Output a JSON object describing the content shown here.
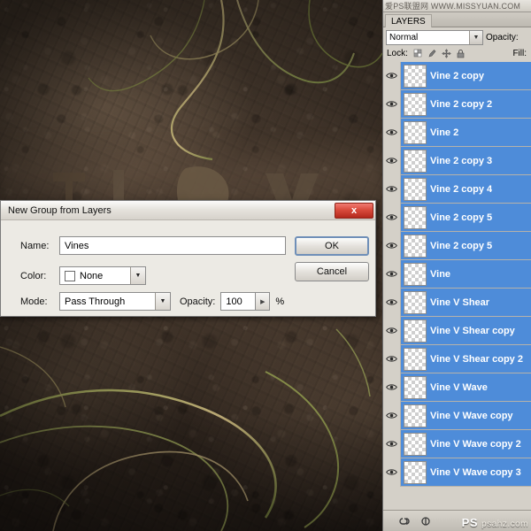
{
  "background": {
    "description": "dark rock texture with vines and embossed letters"
  },
  "layers_panel": {
    "watermark": "爱PS联盟网 WWW.MISSYUAN.COM",
    "tab_label": "LAYERS",
    "blend_mode": "Normal",
    "blend_mode_arrow": "▼",
    "opacity_label": "Opacity:",
    "lock_label": "Lock:",
    "fill_label": "Fill:",
    "lock_icons": [
      "transparency-lock-icon",
      "brush-lock-icon",
      "move-lock-icon",
      "all-lock-icon"
    ],
    "layers": [
      {
        "name": "Vine 2 copy",
        "visible": true,
        "selected": true
      },
      {
        "name": "Vine 2 copy 2",
        "visible": true,
        "selected": true
      },
      {
        "name": "Vine 2",
        "visible": true,
        "selected": true
      },
      {
        "name": "Vine 2 copy 3",
        "visible": true,
        "selected": true
      },
      {
        "name": "Vine 2 copy 4",
        "visible": true,
        "selected": true
      },
      {
        "name": "Vine 2 copy 5",
        "visible": true,
        "selected": true
      },
      {
        "name": "Vine 2 copy 5",
        "visible": true,
        "selected": true
      },
      {
        "name": "Vine",
        "visible": true,
        "selected": true
      },
      {
        "name": "Vine V Shear",
        "visible": true,
        "selected": true
      },
      {
        "name": "Vine V Shear copy",
        "visible": true,
        "selected": true
      },
      {
        "name": "Vine V Shear copy 2",
        "visible": true,
        "selected": true
      },
      {
        "name": "Vine V Wave",
        "visible": true,
        "selected": true
      },
      {
        "name": "Vine V Wave copy",
        "visible": true,
        "selected": true
      },
      {
        "name": "Vine V Wave copy 2",
        "visible": true,
        "selected": true
      },
      {
        "name": "Vine V Wave copy 3",
        "visible": true,
        "selected": true
      }
    ],
    "footer_icons": [
      "link-layers-icon",
      "layer-style-icon"
    ],
    "branding": {
      "mark": "PS",
      "domain": "psahz.com"
    }
  },
  "dialog": {
    "title": "New Group from Layers",
    "close_label": "x",
    "fields": {
      "name_label": "Name:",
      "name_value": "Vines",
      "color_label": "Color:",
      "color_value": "None",
      "color_swatch": "#ffffff",
      "mode_label": "Mode:",
      "mode_value": "Pass Through",
      "opacity_label": "Opacity:",
      "opacity_value": "100",
      "percent_sign": "%",
      "dropdown_arrow": "▼",
      "stepper_arrow": "▶"
    },
    "buttons": {
      "ok": "OK",
      "cancel": "Cancel"
    }
  }
}
